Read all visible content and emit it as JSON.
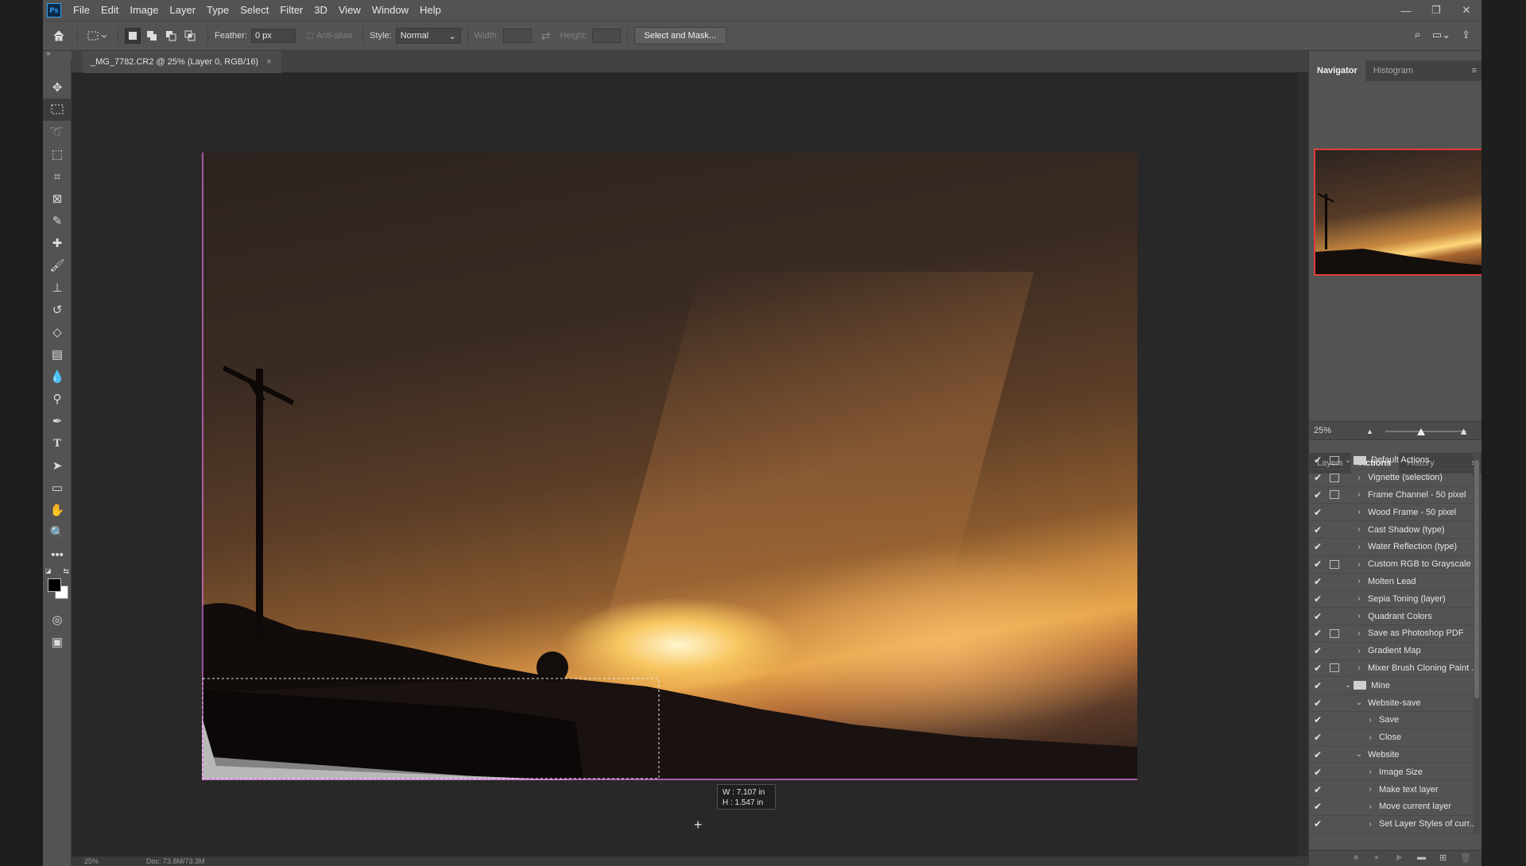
{
  "menubar": {
    "logo": "Ps",
    "items": [
      "File",
      "Edit",
      "Image",
      "Layer",
      "Type",
      "Select",
      "Filter",
      "3D",
      "View",
      "Window",
      "Help"
    ]
  },
  "options": {
    "feather_label": "Feather:",
    "feather_value": "0 px",
    "anti_alias_label": "Anti-alias",
    "style_label": "Style:",
    "style_value": "Normal",
    "width_label": "Width:",
    "height_label": "Height:",
    "select_mask_label": "Select and Mask..."
  },
  "document": {
    "tab_title": "_MG_7782.CR2 @ 25% (Layer 0, RGB/16)",
    "tab_close": "×",
    "tooltip_w": "W :  7.107 in",
    "tooltip_h": "H :  1.547 in",
    "status_zoom": "25%",
    "status_doc": "Doc: 73.8M/73.3M"
  },
  "navigator": {
    "tabs": [
      "Navigator",
      "Histogram"
    ],
    "zoom": "25%"
  },
  "actions_panel": {
    "tabs": [
      "Layers",
      "Actions",
      "History"
    ],
    "rows": [
      {
        "name": "Default Actions",
        "level": 0,
        "folder": true,
        "open": true,
        "dialog": true
      },
      {
        "name": "Vignette (selection)",
        "level": 1,
        "dialog": true
      },
      {
        "name": "Frame Channel - 50 pixel",
        "level": 1,
        "dialog": true
      },
      {
        "name": "Wood Frame - 50 pixel",
        "level": 1,
        "dialog": false
      },
      {
        "name": "Cast Shadow (type)",
        "level": 1,
        "dialog": false
      },
      {
        "name": "Water Reflection (type)",
        "level": 1,
        "dialog": false
      },
      {
        "name": "Custom RGB to Grayscale",
        "level": 1,
        "dialog": true
      },
      {
        "name": "Molten Lead",
        "level": 1,
        "dialog": false
      },
      {
        "name": "Sepia Toning (layer)",
        "level": 1,
        "dialog": false
      },
      {
        "name": "Quadrant Colors",
        "level": 1,
        "dialog": false
      },
      {
        "name": "Save as Photoshop PDF",
        "level": 1,
        "dialog": true
      },
      {
        "name": "Gradient Map",
        "level": 1,
        "dialog": false
      },
      {
        "name": "Mixer Brush Cloning Paint ...",
        "level": 1,
        "dialog": true
      },
      {
        "name": "Mine",
        "level": 0,
        "folder": true,
        "open": true,
        "dialog": false
      },
      {
        "name": "Website-save",
        "level": 1,
        "open": true,
        "dialog": false
      },
      {
        "name": "Save",
        "level": 2,
        "dialog": false
      },
      {
        "name": "Close",
        "level": 2,
        "dialog": false
      },
      {
        "name": "Website",
        "level": 1,
        "open": true,
        "dialog": false
      },
      {
        "name": "Image Size",
        "level": 2,
        "dialog": false
      },
      {
        "name": "Make text layer",
        "level": 2,
        "dialog": false
      },
      {
        "name": "Move current layer",
        "level": 2,
        "dialog": false
      },
      {
        "name": "Set Layer Styles of curr...",
        "level": 2,
        "dialog": false
      }
    ]
  },
  "colors": {
    "selection_outline": "#d66fd6",
    "nav_frame": "#e03b3b"
  }
}
